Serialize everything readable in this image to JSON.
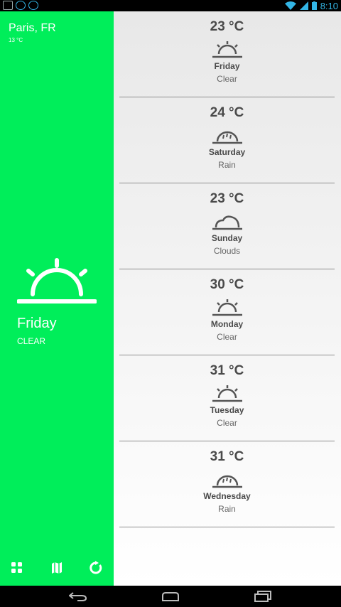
{
  "status_bar": {
    "time": "8:10"
  },
  "location": {
    "city": "Paris, FR",
    "current_temp": "13 °C"
  },
  "today": {
    "day": "Friday",
    "condition": "CLEAR",
    "icon": "sunrise-icon"
  },
  "forecast": [
    {
      "temp": "23 °C",
      "day": "Friday",
      "condition": "Clear",
      "icon": "sunrise-icon"
    },
    {
      "temp": "24 °C",
      "day": "Saturday",
      "condition": "Rain",
      "icon": "rain-icon"
    },
    {
      "temp": "23 °C",
      "day": "Sunday",
      "condition": "Clouds",
      "icon": "cloud-icon"
    },
    {
      "temp": "30 °C",
      "day": "Monday",
      "condition": "Clear",
      "icon": "sunrise-icon"
    },
    {
      "temp": "31 °C",
      "day": "Tuesday",
      "condition": "Clear",
      "icon": "sunrise-icon"
    },
    {
      "temp": "31 °C",
      "day": "Wednesday",
      "condition": "Rain",
      "icon": "rain-icon"
    }
  ],
  "colors": {
    "accent": "#00ee5a",
    "status_blue": "#33b5e5",
    "text_dark": "#4a4a4a"
  }
}
